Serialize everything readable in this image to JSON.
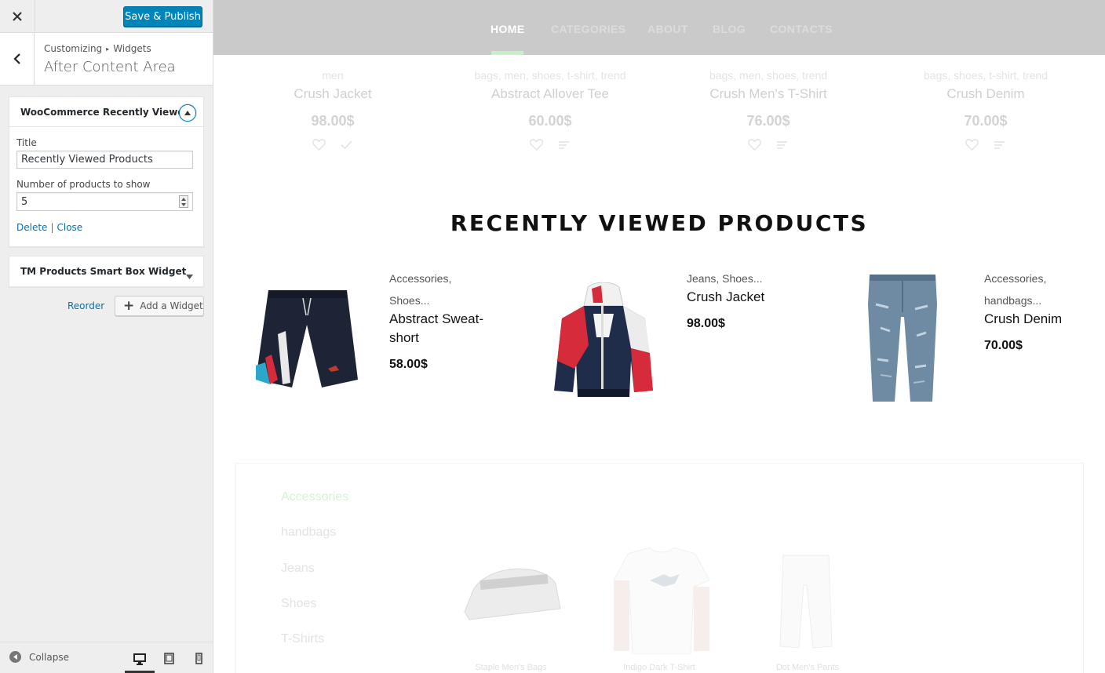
{
  "sidebar": {
    "save_label": "Save & Publish",
    "breadcrumb_root": "Customizing",
    "breadcrumb_parent": "Widgets",
    "section_title": "After Content Area",
    "widget1": {
      "title": "WooCommerce Recently Viewe...",
      "title_label": "Title",
      "title_value": "Recently Viewed Products",
      "count_label": "Number of products to show",
      "count_value": "5",
      "delete_label": "Delete",
      "close_label": "Close"
    },
    "widget2": {
      "title": "TM Products Smart Box Widget"
    },
    "reorder_label": "Reorder",
    "add_widget_label": "Add a Widget",
    "collapse_label": "Collapse"
  },
  "nav": {
    "items": [
      "HOME",
      "CATEGORIES",
      "ABOUT",
      "BLOG",
      "CONTACTS"
    ]
  },
  "featured": [
    {
      "tags": "men",
      "name": "Crush Jacket",
      "price": "98.00$"
    },
    {
      "tags": "bags, men, shoes, t-shirt, trend",
      "name": "Abstract Allover Tee",
      "price": "60.00$"
    },
    {
      "tags": "bags, men, shoes, trend",
      "name": "Crush Men's T-Shirt",
      "price": "76.00$"
    },
    {
      "tags": "bags, shoes, t-shirt, trend",
      "name": "Crush Denim",
      "price": "70.00$"
    }
  ],
  "recently_viewed": {
    "title": "RECENTLY VIEWED PRODUCTS",
    "items": [
      {
        "cat1": "Accessories,",
        "cat2": "Shoes...",
        "name": "Abstract Sweat-short",
        "price": "58.00$"
      },
      {
        "cat1": "Jeans, Shoes...",
        "name": "Crush Jacket",
        "price": "98.00$"
      },
      {
        "cat1": "Accessories,",
        "cat2": "handbags...",
        "name": "Crush Denim",
        "price": "70.00$"
      }
    ]
  },
  "categories": [
    "Accessories",
    "handbags",
    "Jeans",
    "Shoes",
    "T-Shirts"
  ],
  "thumbs": [
    "Staple Men's Bags",
    "Indigo Dark T-Shirt",
    "Dot Men's Pants"
  ],
  "colors": {
    "primary_button": "#0085ba",
    "link": "#0073aa",
    "nav_bg": "#cacaca",
    "nav_accent": "#c9efc6"
  }
}
